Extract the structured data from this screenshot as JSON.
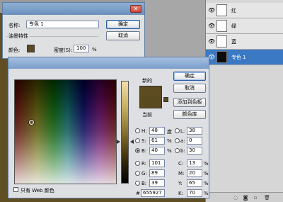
{
  "spot_dialog": {
    "name_label": "名称:",
    "name_value": "专色 1",
    "ink_group_label": "油墨特性",
    "color_label": "颜色:",
    "solidity_label": "密度(S):",
    "solidity_value": "100",
    "solidity_unit": "%",
    "ok_label": "确定",
    "cancel_label": "取消"
  },
  "channels": [
    {
      "label": "红",
      "thumb": "white",
      "selected": false
    },
    {
      "label": "绿",
      "thumb": "white",
      "selected": false
    },
    {
      "label": "蓝",
      "thumb": "white",
      "selected": false
    },
    {
      "label": "专色 1",
      "thumb": "black",
      "selected": true
    }
  ],
  "picker": {
    "new_label": "新的",
    "current_label": "当前",
    "ok_label": "确定",
    "cancel_label": "取消",
    "add_swatch_label": "添加到色板",
    "libraries_label": "颜色库",
    "web_only_label": "只有 Web 颜色",
    "fields": {
      "H": {
        "label": "H:",
        "value": "48",
        "unit": "度"
      },
      "S": {
        "label": "S:",
        "value": "61",
        "unit": "%"
      },
      "Bv": {
        "label": "B:",
        "value": "40",
        "unit": "%"
      },
      "R": {
        "label": "R:",
        "value": "101"
      },
      "G": {
        "label": "G:",
        "value": "89"
      },
      "B2": {
        "label": "B:",
        "value": "39"
      },
      "L": {
        "label": "L:",
        "value": "38"
      },
      "a": {
        "label": "a:",
        "value": "0"
      },
      "b": {
        "label": "b:",
        "value": "30"
      },
      "C": {
        "label": "C:",
        "value": "13",
        "unit": "%"
      },
      "M": {
        "label": "M:",
        "value": "20",
        "unit": "%"
      },
      "Y": {
        "label": "Y:",
        "value": "65",
        "unit": "%"
      },
      "K": {
        "label": "K:",
        "value": "70",
        "unit": "%"
      },
      "hex": {
        "label": "#",
        "value": "655927"
      }
    },
    "selected_mode": "B"
  },
  "colors": {
    "spot_color": "#5a4a20",
    "selection_blue": "#3b79c4"
  }
}
